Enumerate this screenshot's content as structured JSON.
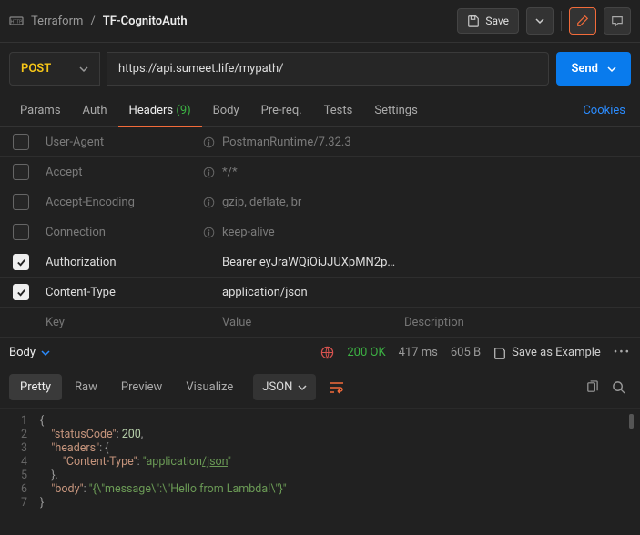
{
  "breadcrumb": {
    "workspace": "Terraform",
    "sep": "/",
    "title": "TF-CognitoAuth"
  },
  "toolbar": {
    "save": "Save"
  },
  "request": {
    "method": "POST",
    "url": "https://api.sumeet.life/mypath/",
    "send": "Send"
  },
  "tabs": {
    "params": "Params",
    "auth": "Auth",
    "headers": "Headers",
    "headers_count": "(9)",
    "body": "Body",
    "prereq": "Pre-req.",
    "tests": "Tests",
    "settings": "Settings",
    "cookies": "Cookies"
  },
  "headers": {
    "auto": [
      {
        "key": "User-Agent",
        "value": "PostmanRuntime/7.32.3"
      },
      {
        "key": "Accept",
        "value": "*/*"
      },
      {
        "key": "Accept-Encoding",
        "value": "gzip, deflate, br"
      },
      {
        "key": "Connection",
        "value": "keep-alive"
      }
    ],
    "user": [
      {
        "key": "Authorization",
        "value": "Bearer eyJraWQiOiJJUXpMN2p…"
      },
      {
        "key": "Content-Type",
        "value": "application/json"
      }
    ],
    "placeholders": {
      "key": "Key",
      "value": "Value",
      "desc": "Description"
    }
  },
  "response": {
    "body_label": "Body",
    "status": "200 OK",
    "time": "417 ms",
    "size": "605 B",
    "save_example": "Save as Example",
    "tabs": {
      "pretty": "Pretty",
      "raw": "Raw",
      "preview": "Preview",
      "visualize": "Visualize"
    },
    "format": "JSON",
    "code": [
      [
        {
          "c": "p",
          "t": "{"
        }
      ],
      [
        {
          "c": "p",
          "t": "    "
        },
        {
          "c": "k",
          "t": "\"statusCode\""
        },
        {
          "c": "p",
          "t": ": "
        },
        {
          "c": "n",
          "t": "200"
        },
        {
          "c": "p",
          "t": ","
        }
      ],
      [
        {
          "c": "p",
          "t": "    "
        },
        {
          "c": "k",
          "t": "\"headers\""
        },
        {
          "c": "p",
          "t": ": {"
        }
      ],
      [
        {
          "c": "p",
          "t": "        "
        },
        {
          "c": "k",
          "t": "\"Content-Type\""
        },
        {
          "c": "p",
          "t": ": "
        },
        {
          "c": "s",
          "t": "\"application"
        },
        {
          "c": "s u",
          "t": "/json"
        },
        {
          "c": "s",
          "t": "\""
        }
      ],
      [
        {
          "c": "p",
          "t": "    },"
        }
      ],
      [
        {
          "c": "p",
          "t": "    "
        },
        {
          "c": "k",
          "t": "\"body\""
        },
        {
          "c": "p",
          "t": ": "
        },
        {
          "c": "s",
          "t": "\"{\\\"message\\\":\\\"Hello from Lambda!\\\"}\""
        }
      ],
      [
        {
          "c": "p",
          "t": "}"
        }
      ]
    ]
  }
}
